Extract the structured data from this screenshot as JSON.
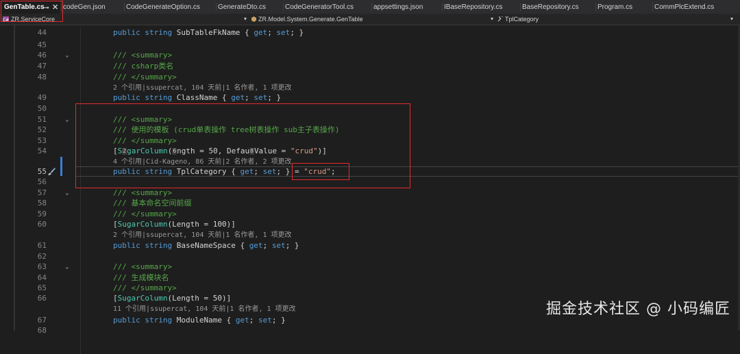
{
  "tabs": [
    {
      "label": "GenTable.cs",
      "active": true
    },
    {
      "label": "codeGen.json"
    },
    {
      "label": "CodeGenerateOption.cs"
    },
    {
      "label": "GenerateDto.cs"
    },
    {
      "label": "CodeGeneratorTool.cs"
    },
    {
      "label": "appsettings.json"
    },
    {
      "label": "IBaseRepository.cs"
    },
    {
      "label": "BaseRepository.cs"
    },
    {
      "label": "Program.cs"
    },
    {
      "label": "CommPlcExtend.cs"
    }
  ],
  "navbar": {
    "project": "ZR.ServiceCore",
    "class": "ZR.Model.System.Generate.GenTable",
    "member": "TplCategory"
  },
  "lines": [
    {
      "n": "44",
      "parts": [
        [
          "kw",
          "public "
        ],
        [
          "kw",
          "string "
        ],
        [
          "id",
          "SubTableFkName "
        ],
        [
          "id",
          "{ "
        ],
        [
          "kw",
          "get"
        ],
        [
          "id",
          "; "
        ],
        [
          "kw",
          "set"
        ],
        [
          "id",
          "; }"
        ]
      ]
    },
    {
      "n": "45",
      "parts": []
    },
    {
      "n": "46",
      "fold": true,
      "parts": [
        [
          "cm",
          "/// <summary>"
        ]
      ]
    },
    {
      "n": "47",
      "parts": [
        [
          "cm",
          "/// csharp类名"
        ]
      ]
    },
    {
      "n": "48",
      "parts": [
        [
          "cm",
          "/// </summary>"
        ]
      ]
    },
    {
      "lens": "2 个引用|ssupercat, 104 天前|1 名作者, 1 项更改"
    },
    {
      "n": "49",
      "parts": [
        [
          "kw",
          "public "
        ],
        [
          "kw",
          "string "
        ],
        [
          "id",
          "ClassName "
        ],
        [
          "id",
          "{ "
        ],
        [
          "kw",
          "get"
        ],
        [
          "id",
          "; "
        ],
        [
          "kw",
          "set"
        ],
        [
          "id",
          "; }"
        ]
      ]
    },
    {
      "n": "50",
      "parts": []
    },
    {
      "n": "51",
      "fold": true,
      "parts": [
        [
          "cm",
          "/// <summary>"
        ]
      ]
    },
    {
      "n": "52",
      "parts": [
        [
          "cm",
          "/// 使用的模板 (crud单表操作 tree树表操作 sub主子表操作)"
        ]
      ]
    },
    {
      "n": "53",
      "parts": [
        [
          "cm",
          "/// </summary>"
        ]
      ]
    },
    {
      "n": "54",
      "parts": [
        [
          "id",
          "["
        ],
        [
          "at",
          "S"
        ],
        [
          "hint",
          "2"
        ],
        [
          "at",
          "garColumn"
        ],
        [
          "id",
          "("
        ],
        [
          "hint",
          "6"
        ],
        [
          "id",
          "ngth = 50, Defau"
        ],
        [
          "hint",
          "8"
        ],
        [
          "id",
          "Value = "
        ],
        [
          "st",
          "\"crud\""
        ],
        [
          "id",
          ")]"
        ]
      ]
    },
    {
      "lens": "4 个引用|Cid-Kageno, 86 天前|2 名作者, 2 项更改"
    },
    {
      "n": "55",
      "current": true,
      "parts": [
        [
          "kw",
          "public "
        ],
        [
          "kw",
          "string "
        ],
        [
          "id",
          "TplCategory "
        ],
        [
          "id",
          "{ "
        ],
        [
          "kw",
          "get"
        ],
        [
          "id",
          "; "
        ],
        [
          "kw",
          "set"
        ],
        [
          "id",
          "; } = "
        ],
        [
          "st",
          "\"crud\""
        ],
        [
          "id",
          ";"
        ]
      ]
    },
    {
      "n": "56",
      "parts": []
    },
    {
      "n": "57",
      "fold": true,
      "parts": [
        [
          "cm",
          "/// <summary>"
        ]
      ]
    },
    {
      "n": "58",
      "parts": [
        [
          "cm",
          "/// 基本命名空间前缀"
        ]
      ]
    },
    {
      "n": "59",
      "parts": [
        [
          "cm",
          "/// </summary>"
        ]
      ]
    },
    {
      "n": "60",
      "parts": [
        [
          "id",
          "["
        ],
        [
          "at",
          "SugarColumn"
        ],
        [
          "id",
          "(Length = 100)]"
        ]
      ]
    },
    {
      "lens": "2 个引用|ssupercat, 104 天前|1 名作者, 1 项更改"
    },
    {
      "n": "61",
      "parts": [
        [
          "kw",
          "public "
        ],
        [
          "kw",
          "string "
        ],
        [
          "id",
          "BaseNameSpace "
        ],
        [
          "id",
          "{ "
        ],
        [
          "kw",
          "get"
        ],
        [
          "id",
          "; "
        ],
        [
          "kw",
          "set"
        ],
        [
          "id",
          "; }"
        ]
      ]
    },
    {
      "n": "62",
      "parts": []
    },
    {
      "n": "63",
      "fold": true,
      "parts": [
        [
          "cm",
          "/// <summary>"
        ]
      ]
    },
    {
      "n": "64",
      "parts": [
        [
          "cm",
          "/// 生成模块名"
        ]
      ]
    },
    {
      "n": "65",
      "parts": [
        [
          "cm",
          "/// </summary>"
        ]
      ]
    },
    {
      "n": "66",
      "parts": [
        [
          "id",
          "["
        ],
        [
          "at",
          "SugarColumn"
        ],
        [
          "id",
          "(Length = 50)]"
        ]
      ]
    },
    {
      "lens": "11 个引用|ssupercat, 104 天前|1 名作者, 1 项更改"
    },
    {
      "n": "67",
      "parts": [
        [
          "kw",
          "public "
        ],
        [
          "kw",
          "string "
        ],
        [
          "id",
          "ModuleName "
        ],
        [
          "id",
          "{ "
        ],
        [
          "kw",
          "get"
        ],
        [
          "id",
          "; "
        ],
        [
          "kw",
          "set"
        ],
        [
          "id",
          "; }"
        ]
      ]
    },
    {
      "n": "68",
      "parts": []
    }
  ],
  "watermark": "掘金技术社区 @ 小码编匠",
  "colors": {
    "highlight_box": "#e52b2b",
    "keyword": "#569cd6",
    "comment": "#57a64a",
    "type": "#4ec9b0",
    "string": "#d69d85"
  }
}
